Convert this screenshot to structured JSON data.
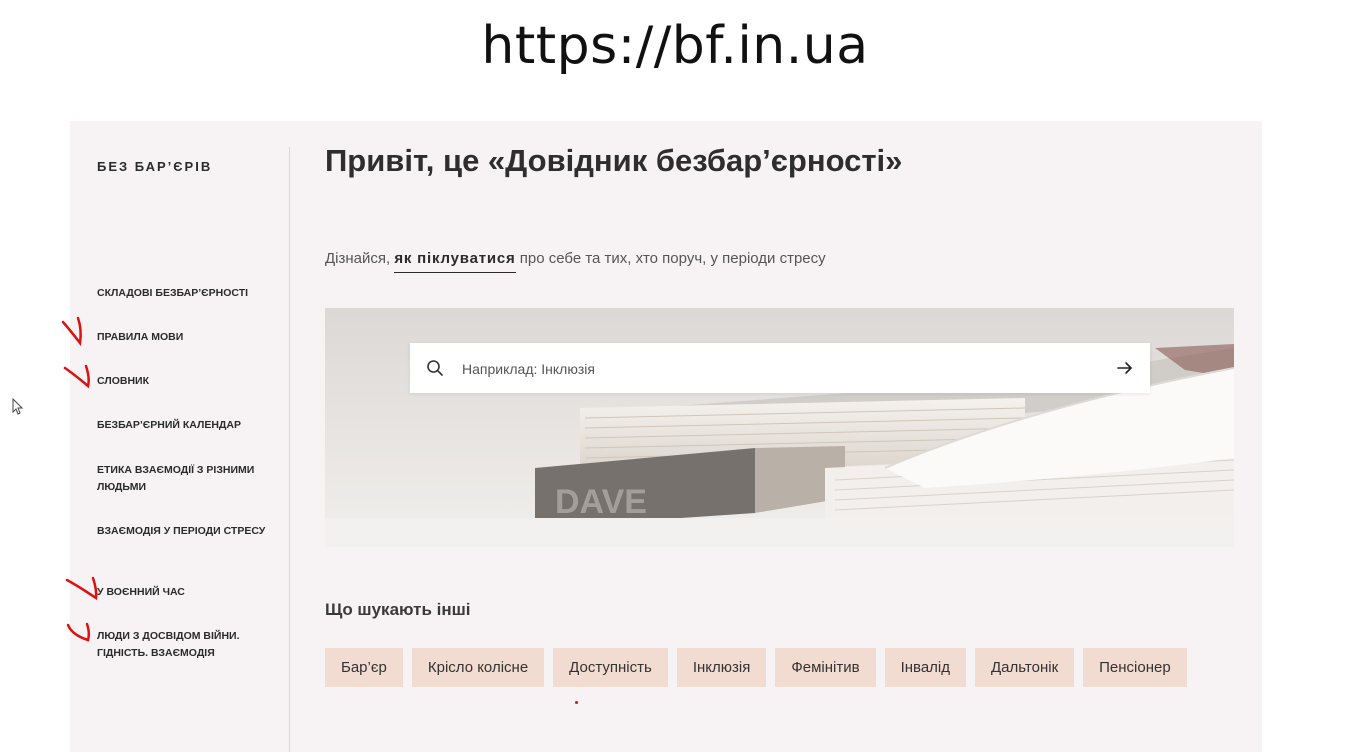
{
  "slide": {
    "url_text": "https://bf.in.ua"
  },
  "site": {
    "logo": "БЕЗ БАР’ЄРІВ",
    "nav": [
      {
        "label": "СКЛАДОВІ БЕЗБАР’ЄРНОСТІ",
        "checked": false
      },
      {
        "label": "ПРАВИЛА МОВИ",
        "checked": true
      },
      {
        "label": "СЛОВНИК",
        "checked": true
      },
      {
        "label": "БЕЗБАР’ЄРНИЙ КАЛЕНДАР",
        "checked": false
      },
      {
        "label": "ЕТИКА ВЗАЄМОДІЇ З РІЗНИМИ ЛЮДЬМИ",
        "checked": false
      },
      {
        "label": "ВЗАЄМОДІЯ У ПЕРІОДИ СТРЕСУ",
        "checked": false
      },
      {
        "label": "У ВОЄННИЙ ЧАС",
        "checked": true
      },
      {
        "label": "ЛЮДИ З ДОСВІДОМ ВІЙНИ. ГІДНІСТЬ. ВЗАЄМОДІЯ",
        "checked": true
      }
    ],
    "title": "Привіт, це «Довідник безбар’єрності»",
    "intro": {
      "before": "Дізнайся, ",
      "link": "як піклуватися",
      "after": " про себе та тих, хто поруч, у періоди стресу"
    },
    "search": {
      "placeholder": "Наприклад: Інклюзія",
      "search_icon": "search-icon",
      "submit_icon": "arrow-right-icon"
    },
    "popular": {
      "heading": "Що шукають інші",
      "tags": [
        "Бар’єр",
        "Крісло колісне",
        "Доступність",
        "Інклюзія",
        "Фемінітив",
        "Інвалід",
        "Дальтонік",
        "Пенсіонер"
      ]
    }
  },
  "colors": {
    "page_bg": "#f7f3f4",
    "tag_bg": "#f2dbd1",
    "annotation": "#dd1111"
  }
}
